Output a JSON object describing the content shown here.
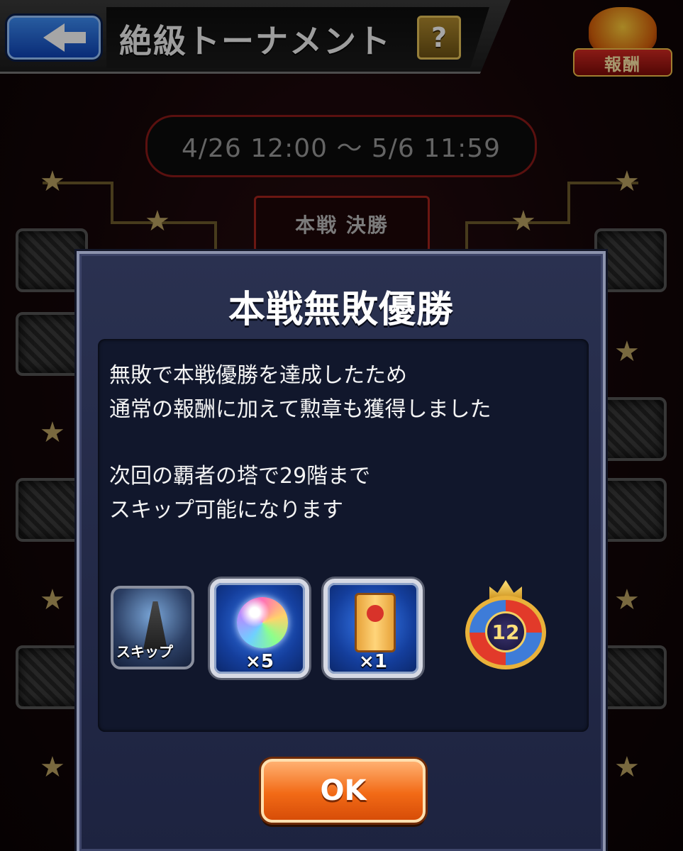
{
  "header": {
    "title": "絶級トーナメント",
    "help_label": "?",
    "reward_badge_label": "報酬"
  },
  "period": "4/26 12:00 〜 5/6 11:59",
  "bracket": {
    "match_label": "本戦 決勝"
  },
  "modal": {
    "title": "本戦無敗優勝",
    "message_lines": [
      "無敗で本戦優勝を達成したため",
      "通常の報酬に加えて勲章も獲得しました",
      "",
      "次回の覇者の塔で29階まで",
      "スキップ可能になります"
    ],
    "rewards": {
      "skip": {
        "label": "スキップ",
        "icon": "tower-icon"
      },
      "orb": {
        "quantity": "×5",
        "icon": "rainbow-orb-icon"
      },
      "scroll": {
        "quantity": "×1",
        "icon": "scroll-icon"
      },
      "medal": {
        "number": "12",
        "icon": "medal-icon"
      }
    },
    "ok_label": "OK"
  },
  "colors": {
    "modal_bg": "#1d2340",
    "ok_button": "#f26a16",
    "back_button": "#1f63d8",
    "accent_gold": "#bba262"
  }
}
